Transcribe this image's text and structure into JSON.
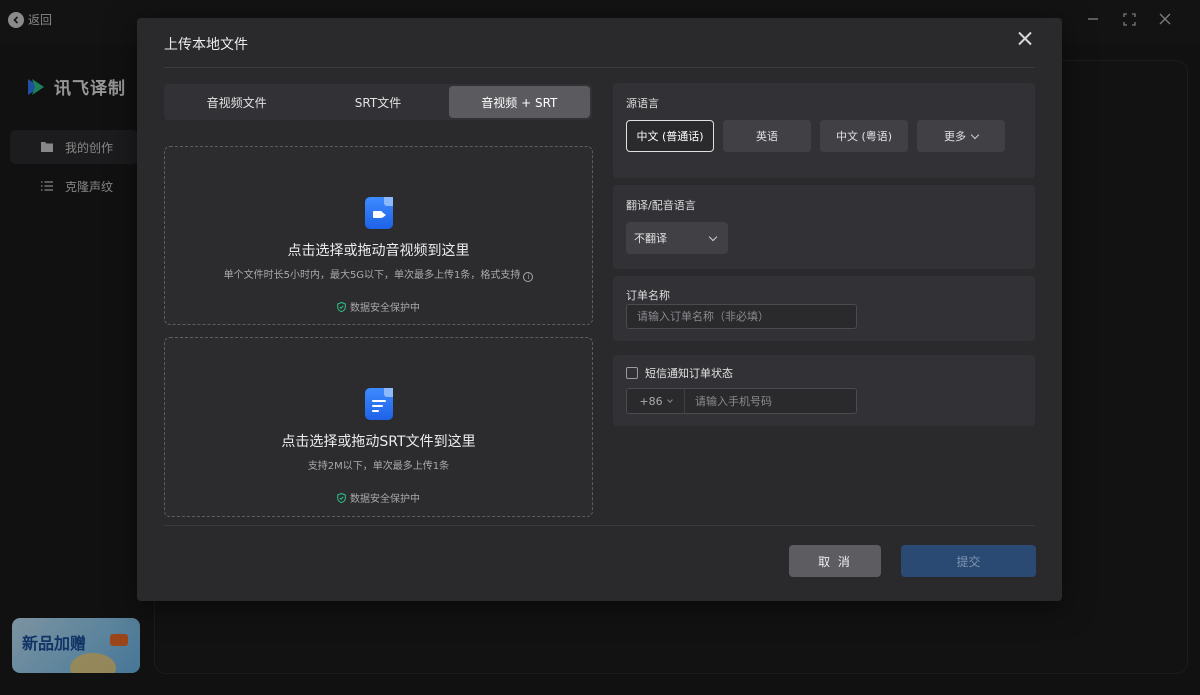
{
  "app": {
    "back_label": "返回",
    "logo_text": "讯飞译制",
    "brand_colors": {
      "accent_green": "#2ec58a",
      "accent_blue": "#2f7cf6"
    }
  },
  "sidebar": {
    "items": [
      {
        "label": "我的创作",
        "icon": "folder-icon",
        "active": true
      },
      {
        "label": "克隆声纹",
        "icon": "list-icon",
        "active": false
      }
    ],
    "promo_text": "新品加赠"
  },
  "modal": {
    "title": "上传本地文件",
    "tabs": [
      {
        "label": "音视频文件",
        "active": false
      },
      {
        "label": "SRT文件",
        "active": false
      },
      {
        "label": "音视频 + SRT",
        "active": true
      }
    ],
    "video_drop": {
      "title": "点击选择或拖动音视频到这里",
      "subtitle": "单个文件时长5小时内，最大5G以下，单次最多上传1条，格式支持",
      "secure": "数据安全保护中"
    },
    "srt_drop": {
      "title": "点击选择或拖动SRT文件到这里",
      "subtitle": "支持2M以下，单次最多上传1条",
      "secure": "数据安全保护中"
    },
    "source_language": {
      "label": "源语言",
      "options": [
        "中文 (普通话)",
        "英语",
        "中文 (粤语)",
        "更多"
      ],
      "selected": "中文 (普通话)"
    },
    "translate_language": {
      "label": "翻译/配音语言",
      "value": "不翻译"
    },
    "order_name": {
      "label": "订单名称",
      "placeholder": "请输入订单名称（非必填）"
    },
    "sms": {
      "label": "短信通知订单状态",
      "checked": false,
      "country_code": "+86",
      "phone_placeholder": "请输入手机号码"
    },
    "cancel_label": "取 消",
    "submit_label": "提交"
  }
}
